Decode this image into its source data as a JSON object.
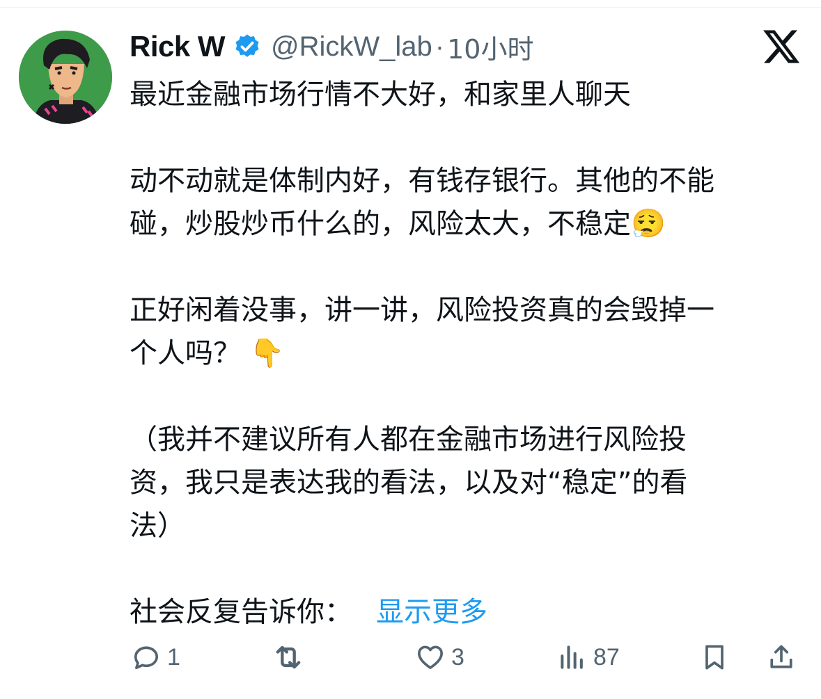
{
  "tweet": {
    "author_name": "Rick W",
    "handle": "@RickW_lab",
    "separator": "·",
    "time": "10小时",
    "lines": [
      "最近金融市场行情不大好，和家里人聊天",
      "",
      "动不动就是体制内好，有钱存银行。其他的不能",
      "碰，炒股炒币什么的，风险太大，不稳定😮‍💨",
      "",
      "正好闲着没事，讲一讲，风险投资真的会毁掉一",
      "个人吗？ 👇",
      "",
      "（我并不建议所有人都在金融市场进行风险投",
      "资，我只是表达我的看法，以及对“稳定”的看",
      "法）",
      "",
      "社会反复告诉你："
    ],
    "show_more": "显示更多"
  },
  "actions": {
    "reply_count": "1",
    "like_count": "3",
    "views_count": "87"
  },
  "icons": {
    "verified": "verified-badge-icon",
    "logo": "x-logo-icon",
    "reply": "reply-icon",
    "retweet": "retweet-icon",
    "like": "heart-icon",
    "views": "views-icon",
    "bookmark": "bookmark-icon",
    "share": "share-icon"
  },
  "colors": {
    "text": "#0f1419",
    "secondary": "#536471",
    "link": "#1d9bf0"
  }
}
